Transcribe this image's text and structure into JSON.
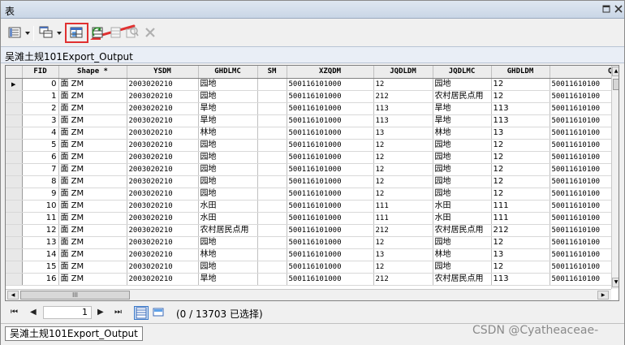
{
  "window": {
    "title": "表"
  },
  "toolbar": {
    "icons": [
      "table-options-icon",
      "related-tables-icon",
      "select-by-attributes-icon",
      "switch-selection-icon",
      "clear-selection-icon",
      "zoom-to-selected-icon",
      "delete-selected-icon"
    ]
  },
  "layer_tab": {
    "label": "吴滩土规101Export_Output"
  },
  "table": {
    "columns": [
      "FID",
      "Shape *",
      "YSDM",
      "GHDLMC",
      "SM",
      "XZQDM",
      "JQDLDM",
      "JQDLMC",
      "GHDLDM",
      "Q"
    ],
    "rows": [
      [
        "0",
        "面 ZM",
        "2003020210",
        "园地",
        "",
        "500116101000",
        "12",
        "园地",
        "12",
        "50011610100"
      ],
      [
        "1",
        "面 ZM",
        "2003020210",
        "园地",
        "",
        "500116101000",
        "212",
        "农村居民点用",
        "12",
        "50011610100"
      ],
      [
        "2",
        "面 ZM",
        "2003020210",
        "旱地",
        "",
        "500116101000",
        "113",
        "旱地",
        "113",
        "50011610100"
      ],
      [
        "3",
        "面 ZM",
        "2003020210",
        "旱地",
        "",
        "500116101000",
        "113",
        "旱地",
        "113",
        "50011610100"
      ],
      [
        "4",
        "面 ZM",
        "2003020210",
        "林地",
        "",
        "500116101000",
        "13",
        "林地",
        "13",
        "50011610100"
      ],
      [
        "5",
        "面 ZM",
        "2003020210",
        "园地",
        "",
        "500116101000",
        "12",
        "园地",
        "12",
        "50011610100"
      ],
      [
        "6",
        "面 ZM",
        "2003020210",
        "园地",
        "",
        "500116101000",
        "12",
        "园地",
        "12",
        "50011610100"
      ],
      [
        "7",
        "面 ZM",
        "2003020210",
        "园地",
        "",
        "500116101000",
        "12",
        "园地",
        "12",
        "50011610100"
      ],
      [
        "8",
        "面 ZM",
        "2003020210",
        "园地",
        "",
        "500116101000",
        "12",
        "园地",
        "12",
        "50011610100"
      ],
      [
        "9",
        "面 ZM",
        "2003020210",
        "园地",
        "",
        "500116101000",
        "12",
        "园地",
        "12",
        "50011610100"
      ],
      [
        "10",
        "面 ZM",
        "2003020210",
        "水田",
        "",
        "500116101000",
        "111",
        "水田",
        "111",
        "50011610100"
      ],
      [
        "11",
        "面 ZM",
        "2003020210",
        "水田",
        "",
        "500116101000",
        "111",
        "水田",
        "111",
        "50011610100"
      ],
      [
        "12",
        "面 ZM",
        "2003020210",
        "农村居民点用",
        "",
        "500116101000",
        "212",
        "农村居民点用",
        "212",
        "50011610100"
      ],
      [
        "13",
        "面 ZM",
        "2003020210",
        "园地",
        "",
        "500116101000",
        "12",
        "园地",
        "12",
        "50011610100"
      ],
      [
        "14",
        "面 ZM",
        "2003020210",
        "林地",
        "",
        "500116101000",
        "13",
        "林地",
        "13",
        "50011610100"
      ],
      [
        "15",
        "面 ZM",
        "2003020210",
        "园地",
        "",
        "500116101000",
        "12",
        "园地",
        "12",
        "50011610100"
      ],
      [
        "16",
        "面 ZM",
        "2003020210",
        "旱地",
        "",
        "500116101000",
        "212",
        "农村居民点用",
        "113",
        "50011610100"
      ]
    ]
  },
  "navigation": {
    "first": "⏮",
    "prev": "◀",
    "page": "1",
    "next": "▶",
    "last": "⏭",
    "status": "(0 / 13703 已选择)"
  },
  "bottom_tab": {
    "label": "吴滩土规101Export_Output"
  },
  "watermark": "CSDN @Cyatheaceae-",
  "colors": {
    "highlight": "#e03030",
    "grid_header": "#ececec"
  }
}
